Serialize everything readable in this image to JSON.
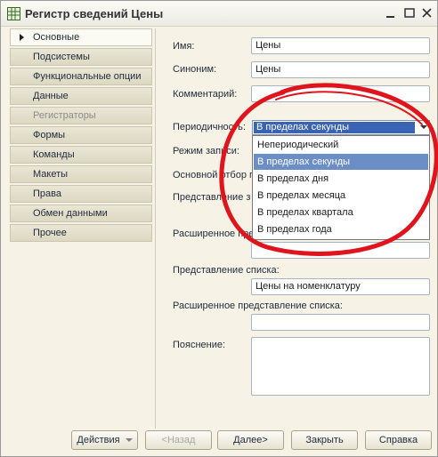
{
  "window": {
    "title": "Регистр сведений Цены"
  },
  "sidebar": {
    "items": [
      {
        "label": "Основные"
      },
      {
        "label": "Подсистемы"
      },
      {
        "label": "Функциональные опции"
      },
      {
        "label": "Данные"
      },
      {
        "label": "Регистраторы"
      },
      {
        "label": "Формы"
      },
      {
        "label": "Команды"
      },
      {
        "label": "Макеты"
      },
      {
        "label": "Права"
      },
      {
        "label": "Обмен данными"
      },
      {
        "label": "Прочее"
      }
    ]
  },
  "form": {
    "name_label": "Имя:",
    "name_value": "Цены",
    "synonym_label": "Синоним:",
    "synonym_value": "Цены",
    "comment_label": "Комментарий:",
    "comment_value": "",
    "periodicity_label": "Периодичность:",
    "periodicity_value": "В пределах секунды",
    "write_mode_label": "Режим записи:",
    "main_filter_label": "Основной отбор п",
    "presentation_label": "Представление з",
    "extended_presentation_label": "Расширенное пре",
    "list_presentation_label": "Представление списка:",
    "list_presentation_value": "Цены на номенклатуру",
    "extended_list_presentation_label": "Расширенное представление списка:",
    "extended_list_presentation_value": "",
    "explanation_label": "Пояснение:",
    "explanation_value": ""
  },
  "periodicity_options": [
    "Непериодический",
    "В пределах секунды",
    "В пределах дня",
    "В пределах месяца",
    "В пределах квартала",
    "В пределах года"
  ],
  "buttons": {
    "actions": "Действия",
    "back": "<Назад",
    "next": "Далее>",
    "close": "Закрыть",
    "help": "Справка"
  },
  "colors": {
    "selection": "#3b63b3",
    "list_selection": "#6c8ec7",
    "annotation": "#e0141c"
  }
}
